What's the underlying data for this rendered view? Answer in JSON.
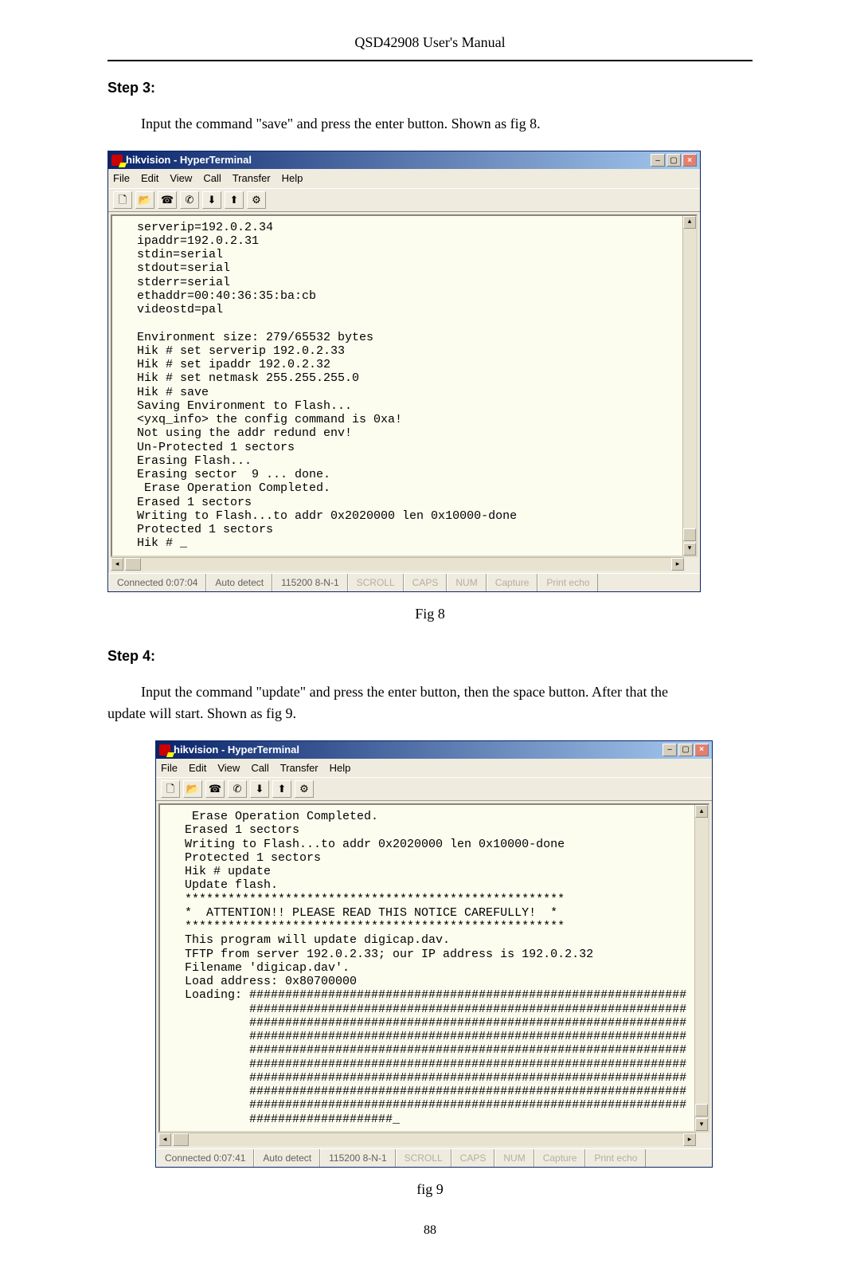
{
  "header_title": "QSD42908 User's Manual",
  "step3_heading": "Step 3:",
  "step3_text": "Input the command \"save\" and press the enter button. Shown as fig 8.",
  "fig8_caption": "Fig 8",
  "step4_heading": "Step 4:",
  "step4_text_l1": "Input the command \"update\" and press the enter button, then the space button. After that the",
  "step4_text_l2": "update will start. Shown as fig 9.",
  "fig9_caption": "fig 9",
  "page_number": "88",
  "hterm": {
    "title": "hikvision - HyperTerminal",
    "menus": [
      "File",
      "Edit",
      "View",
      "Call",
      "Transfer",
      "Help"
    ],
    "toolbar_icons": [
      "new-icon",
      "open-icon",
      "connect-icon",
      "disconnect-icon",
      "send-icon",
      "receive-icon",
      "properties-icon"
    ]
  },
  "term1_lines": "serverip=192.0.2.34\nipaddr=192.0.2.31\nstdin=serial\nstdout=serial\nstderr=serial\nethaddr=00:40:36:35:ba:cb\nvideostd=pal\n\nEnvironment size: 279/65532 bytes\nHik # set serverip 192.0.2.33\nHik # set ipaddr 192.0.2.32\nHik # set netmask 255.255.255.0\nHik # save\nSaving Environment to Flash...\n<yxq_info> the config command is 0xa!\nNot using the addr redund env!\nUn-Protected 1 sectors\nErasing Flash...\nErasing sector  9 ... done.\n Erase Operation Completed.\nErased 1 sectors\nWriting to Flash...to addr 0x2020000 len 0x10000-done\nProtected 1 sectors\nHik # _",
  "status1": {
    "connected": "Connected 0:07:04",
    "detect": "Auto detect",
    "speed": "115200 8-N-1",
    "scroll": "SCROLL",
    "caps": "CAPS",
    "num": "NUM",
    "capture": "Capture",
    "echo": "Print echo"
  },
  "term2_head": " Erase Operation Completed.\nErased 1 sectors\nWriting to Flash...to addr 0x2020000 len 0x10000-done\nProtected 1 sectors\nHik # update\nUpdate flash.",
  "term2_starline": "*****************************************************",
  "term2_attn": "*  ATTENTION!! PLEASE READ THIS NOTICE CAREFULLY!  *",
  "term2_starline2": "*****************************************************",
  "term2_body": "\nThis program will update digicap.dav.\nTFTP from server 192.0.2.33; our IP address is 192.0.2.32\nFilename 'digicap.dav'.\nLoad address: 0x80700000",
  "term2_loading_label": "Loading: ",
  "term2_hash_full": "#############################################################",
  "term2_hash_indent": "         #############################################################",
  "term2_hash_last": "         ####################_",
  "status2": {
    "connected": "Connected 0:07:41",
    "detect": "Auto detect",
    "speed": "115200 8-N-1",
    "scroll": "SCROLL",
    "caps": "CAPS",
    "num": "NUM",
    "capture": "Capture",
    "echo": "Print echo"
  }
}
